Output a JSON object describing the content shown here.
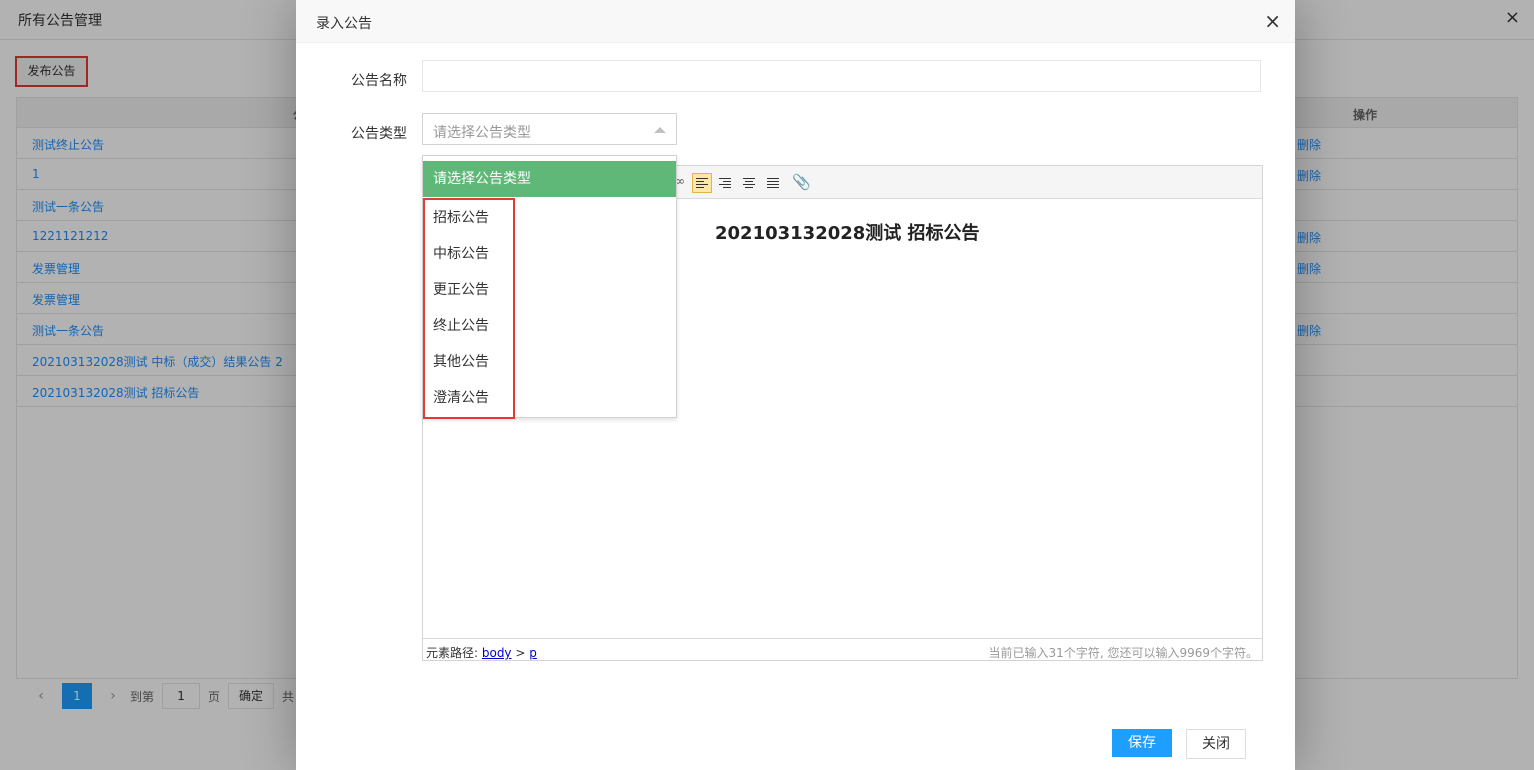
{
  "page": {
    "title": "所有公告管理",
    "close_icon": "×",
    "publish_button": "发布公告",
    "table": {
      "col_title": "公",
      "col_actions": "操作",
      "rows": [
        {
          "title": "测试终止公告",
          "action": "删除"
        },
        {
          "title": "1",
          "action": "删除"
        },
        {
          "title": "测试一条公告",
          "action": ""
        },
        {
          "title": "1221121212",
          "action": "删除"
        },
        {
          "title": "发票管理",
          "action": "删除"
        },
        {
          "title": "发票管理",
          "action": ""
        },
        {
          "title": "测试一条公告",
          "action": "删除"
        },
        {
          "title": "202103132028测试 中标（成交）结果公告 2",
          "action": ""
        },
        {
          "title": "202103132028测试 招标公告",
          "action": ""
        }
      ]
    },
    "pager": {
      "prev": "‹",
      "current": "1",
      "next": "›",
      "goto_label": "到第",
      "page_value": "1",
      "page_unit": "页",
      "confirm": "确定",
      "total_prefix": "共"
    }
  },
  "dialog": {
    "title": "录入公告",
    "close_icon": "×",
    "name_label": "公告名称",
    "name_value": "",
    "type_label": "公告类型",
    "type_placeholder": "请选择公告类型",
    "dropdown": {
      "selected": "请选择公告类型",
      "options": [
        "招标公告",
        "中标公告",
        "更正公告",
        "终止公告",
        "其他公告",
        "澄清公告"
      ]
    },
    "editor": {
      "heading": "202103132028测试 招标公告",
      "path_label": "元素路径: ",
      "path_body": "body",
      "path_sep": " > ",
      "path_p": "p",
      "counter": "当前已输入31个字符, 您还可以输入9969个字符。"
    },
    "save_button": "保存",
    "close_button": "关闭"
  },
  "colors": {
    "primary": "#1e9fff",
    "selected_option": "#5fb878",
    "highlight_border": "#e53935",
    "link": "#1e90ff"
  }
}
